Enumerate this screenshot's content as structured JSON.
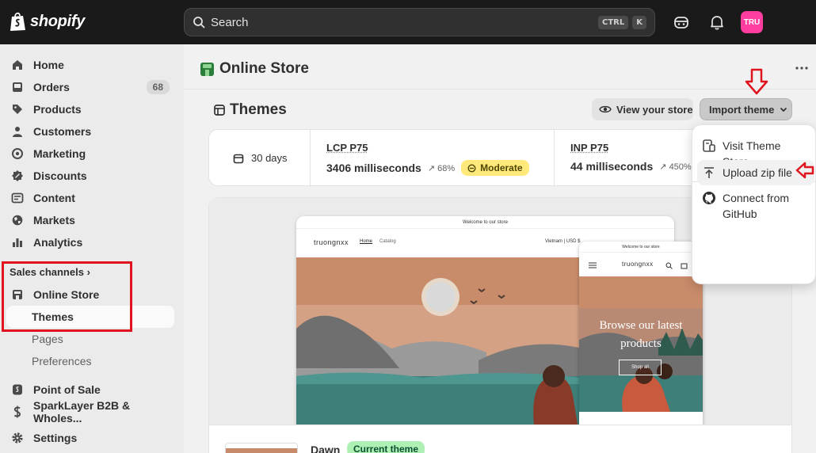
{
  "brand": {
    "name": "shopify"
  },
  "search": {
    "placeholder": "Search",
    "shortcut_1": "CTRL",
    "shortcut_2": "K"
  },
  "user": {
    "initials": "TRU"
  },
  "sidebar": {
    "items": [
      {
        "label": "Home",
        "icon": "home-icon"
      },
      {
        "label": "Orders",
        "icon": "orders-icon",
        "badge": "68"
      },
      {
        "label": "Products",
        "icon": "tag-icon"
      },
      {
        "label": "Customers",
        "icon": "person-icon"
      },
      {
        "label": "Marketing",
        "icon": "target-icon"
      },
      {
        "label": "Discounts",
        "icon": "discount-icon"
      },
      {
        "label": "Content",
        "icon": "content-icon"
      },
      {
        "label": "Markets",
        "icon": "globe-icon"
      },
      {
        "label": "Analytics",
        "icon": "bar-chart-icon"
      }
    ],
    "sales_channels_label": "Sales channels",
    "online_store": "Online Store",
    "sub_items": [
      "Themes",
      "Pages",
      "Preferences"
    ],
    "apps": [
      {
        "label": "Point of Sale",
        "icon": "pos-icon"
      },
      {
        "label": "SparkLayer B2B & Wholes...",
        "icon": "app-icon"
      }
    ],
    "settings": "Settings"
  },
  "main": {
    "page_title": "Online Store",
    "section_title": "Themes",
    "view_store_label": "View your store",
    "import_theme_label": "Import theme",
    "metrics": {
      "period": "30 days",
      "lcp_label": "LCP P75",
      "lcp_value": "3406 milliseconds",
      "lcp_pct": "68%",
      "lcp_status": "Moderate",
      "inp_label": "INP P75",
      "inp_value": "44 milliseconds",
      "inp_pct": "450%"
    },
    "preview": {
      "announcement": "Welcome to our store",
      "store_name": "truongnxx",
      "nav_home": "Home",
      "nav_catalog": "Catalog",
      "locale": "Vietnam | USD $",
      "headline": "Browse our latest products",
      "shop_all": "Shop all"
    },
    "current_theme": {
      "name": "Dawn",
      "status": "Current theme"
    }
  },
  "dropdown": {
    "items": [
      "Visit Theme Store",
      "Upload zip file",
      "Connect from GitHub"
    ]
  },
  "colors": {
    "topbar": "#1a1a1a",
    "annotation": "#e0141e",
    "avatar": "#ff3d9e",
    "moderate": "#ffe97a",
    "current": "#aff0b5"
  }
}
